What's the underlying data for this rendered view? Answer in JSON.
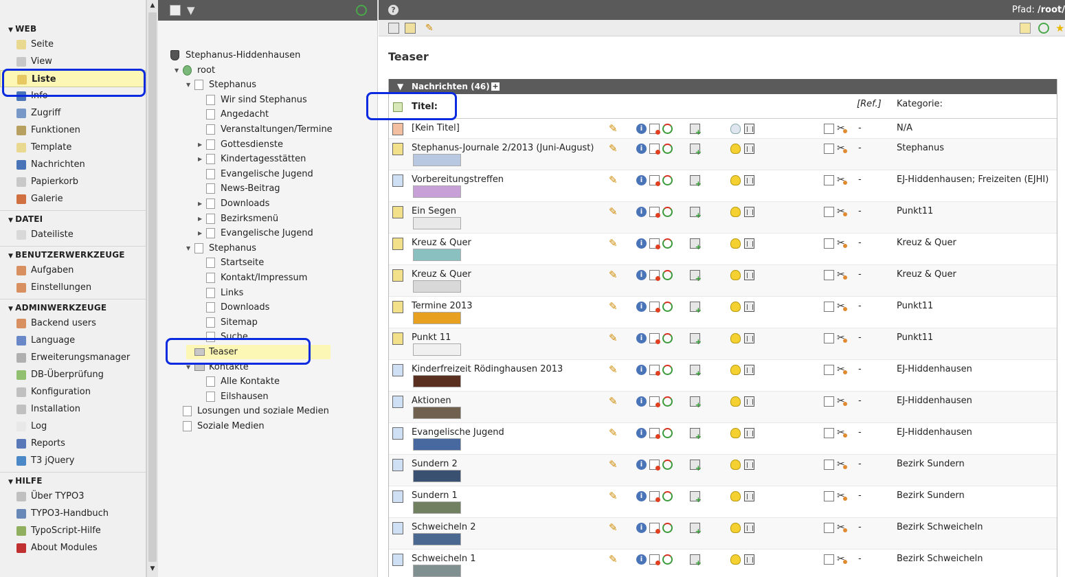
{
  "modmenu": {
    "groups": [
      {
        "title": "WEB",
        "items": [
          {
            "label": "Seite",
            "icon": "page-icon",
            "color": "#e8d890"
          },
          {
            "label": "View",
            "icon": "eye-icon",
            "color": "#c8c8c8"
          },
          {
            "label": "Liste",
            "icon": "list-icon",
            "color": "#e8c860"
          },
          {
            "label": "Info",
            "icon": "info-icon",
            "color": "#4a74b8"
          },
          {
            "label": "Zugriff",
            "icon": "access-icon",
            "color": "#7898c8"
          },
          {
            "label": "Funktionen",
            "icon": "wrench-icon",
            "color": "#b8a060"
          },
          {
            "label": "Template",
            "icon": "template-icon",
            "color": "#e8d890"
          },
          {
            "label": "Nachrichten",
            "icon": "news-icon",
            "color": "#4a74b8"
          },
          {
            "label": "Papierkorb",
            "icon": "trash-icon",
            "color": "#c8c8c8"
          },
          {
            "label": "Galerie",
            "icon": "gallery-icon",
            "color": "#d07040"
          }
        ]
      },
      {
        "title": "DATEI",
        "items": [
          {
            "label": "Dateiliste",
            "icon": "folder-icon",
            "color": "#d8d8d8"
          }
        ]
      },
      {
        "title": "BENUTZERWERKZEUGE",
        "items": [
          {
            "label": "Aufgaben",
            "icon": "tasks-icon",
            "color": "#d89060"
          },
          {
            "label": "Einstellungen",
            "icon": "user-settings-icon",
            "color": "#d89060"
          }
        ]
      },
      {
        "title": "ADMINWERKZEUGE",
        "items": [
          {
            "label": "Backend users",
            "icon": "users-icon",
            "color": "#d89060"
          },
          {
            "label": "Language",
            "icon": "language-icon",
            "color": "#6888c8"
          },
          {
            "label": "Erweiterungsmanager",
            "icon": "extension-icon",
            "color": "#b0b0b0"
          },
          {
            "label": "DB-Überprüfung",
            "icon": "db-check-icon",
            "color": "#90c070"
          },
          {
            "label": "Konfiguration",
            "icon": "config-icon",
            "color": "#c0c0c0"
          },
          {
            "label": "Installation",
            "icon": "install-icon",
            "color": "#c0c0c0"
          },
          {
            "label": "Log",
            "icon": "log-icon",
            "color": "#e8e8e8"
          },
          {
            "label": "Reports",
            "icon": "reports-icon",
            "color": "#5878b8"
          },
          {
            "label": "T3 jQuery",
            "icon": "jquery-icon",
            "color": "#4a88c8"
          }
        ]
      },
      {
        "title": "HILFE",
        "items": [
          {
            "label": "Über TYPO3",
            "icon": "about-icon",
            "color": "#c0c0c0"
          },
          {
            "label": "TYPO3-Handbuch",
            "icon": "manual-icon",
            "color": "#6888b8"
          },
          {
            "label": "TypoScript-Hilfe",
            "icon": "typoscript-icon",
            "color": "#90b060"
          },
          {
            "label": "About Modules",
            "icon": "about-modules-icon",
            "color": "#c03030"
          }
        ]
      }
    ]
  },
  "tree": {
    "nodes": [
      {
        "label": "Stephanus-Hiddenhausen",
        "level": 0,
        "exp": "",
        "kind": "site"
      },
      {
        "label": "root",
        "level": 1,
        "exp": "▼",
        "kind": "root"
      },
      {
        "label": "Stephanus",
        "level": 2,
        "exp": "▼",
        "kind": "page"
      },
      {
        "label": "Wir sind Stephanus",
        "level": 3,
        "exp": "",
        "kind": "page"
      },
      {
        "label": "Angedacht",
        "level": 3,
        "exp": "",
        "kind": "page"
      },
      {
        "label": "Veranstaltungen/Termine",
        "level": 3,
        "exp": "",
        "kind": "page"
      },
      {
        "label": "Gottesdienste",
        "level": 3,
        "exp": "▶",
        "kind": "page"
      },
      {
        "label": "Kindertagesstätten",
        "level": 3,
        "exp": "▶",
        "kind": "page"
      },
      {
        "label": "Evangelische Jugend",
        "level": 3,
        "exp": "",
        "kind": "page"
      },
      {
        "label": "News-Beitrag",
        "level": 3,
        "exp": "",
        "kind": "page"
      },
      {
        "label": "Downloads",
        "level": 3,
        "exp": "▶",
        "kind": "page"
      },
      {
        "label": "Bezirksmenü",
        "level": 3,
        "exp": "▶",
        "kind": "page"
      },
      {
        "label": "Evangelische Jugend",
        "level": 3,
        "exp": "▶",
        "kind": "page"
      },
      {
        "label": "Stephanus",
        "level": 2,
        "exp": "▼",
        "kind": "page"
      },
      {
        "label": "Startseite",
        "level": 3,
        "exp": "",
        "kind": "page"
      },
      {
        "label": "Kontakt/Impressum",
        "level": 3,
        "exp": "",
        "kind": "page"
      },
      {
        "label": "Links",
        "level": 3,
        "exp": "",
        "kind": "page"
      },
      {
        "label": "Downloads",
        "level": 3,
        "exp": "",
        "kind": "page"
      },
      {
        "label": "Sitemap",
        "level": 3,
        "exp": "",
        "kind": "page"
      },
      {
        "label": "Suche",
        "level": 3,
        "exp": "",
        "kind": "page"
      },
      {
        "label": "Teaser",
        "level": 2,
        "exp": "",
        "kind": "folder"
      },
      {
        "label": "Kontakte",
        "level": 2,
        "exp": "▼",
        "kind": "folder"
      },
      {
        "label": "Alle Kontakte",
        "level": 3,
        "exp": "",
        "kind": "page"
      },
      {
        "label": "Eilshausen",
        "level": 3,
        "exp": "",
        "kind": "page"
      },
      {
        "label": "Losungen und soziale Medien",
        "level": 1,
        "exp": "",
        "kind": "page"
      },
      {
        "label": "Soziale Medien",
        "level": 1,
        "exp": "",
        "kind": "page"
      }
    ]
  },
  "main": {
    "help_label": "?",
    "path_prefix": "Pfad: ",
    "path_value": "/root/",
    "page_title": "Teaser",
    "table": {
      "section_title": "Nachrichten (46)",
      "plus": "+",
      "col_title": "Titel:",
      "col_ref": "[Ref.]",
      "col_category": "Kategorie:",
      "rows": [
        {
          "title": "[Kein Titel]",
          "ref": "-",
          "category": "N/A",
          "icon": "red",
          "thumb": "",
          "hidden": true
        },
        {
          "title": "Stephanus-Journale 2/2013 (Juni-August)",
          "ref": "-",
          "category": "Stephanus",
          "icon": "yellow",
          "thumb": "#b8c8e0",
          "hidden": false
        },
        {
          "title": "Vorbereitungstreffen",
          "ref": "-",
          "category": "EJ-Hiddenhausen; Freizeiten (EJHI)",
          "icon": "blue",
          "thumb": "#c8a0d8",
          "hidden": false
        },
        {
          "title": "Ein Segen",
          "ref": "-",
          "category": "Punkt11",
          "icon": "yellow",
          "thumb": "#e8e8e8",
          "hidden": false
        },
        {
          "title": "Kreuz & Quer",
          "ref": "-",
          "category": "Kreuz & Quer",
          "icon": "yellow",
          "thumb": "#8ac0c0",
          "hidden": false
        },
        {
          "title": "Kreuz & Quer",
          "ref": "-",
          "category": "Kreuz & Quer",
          "icon": "yellow",
          "thumb": "#d8d8d8",
          "hidden": false
        },
        {
          "title": "Termine 2013",
          "ref": "-",
          "category": "Punkt11",
          "icon": "yellow",
          "thumb": "#e8a020",
          "hidden": false
        },
        {
          "title": "Punkt 11",
          "ref": "-",
          "category": "Punkt11",
          "icon": "yellow",
          "thumb": "#f0f0f0",
          "hidden": false
        },
        {
          "title": "Kinderfreizeit Rödinghausen 2013",
          "ref": "-",
          "category": "EJ-Hiddenhausen",
          "icon": "blue",
          "thumb": "#5a3020",
          "hidden": false
        },
        {
          "title": "Aktionen",
          "ref": "-",
          "category": "EJ-Hiddenhausen",
          "icon": "blue",
          "thumb": "#706050",
          "hidden": false
        },
        {
          "title": "Evangelische Jugend",
          "ref": "-",
          "category": "EJ-Hiddenhausen",
          "icon": "blue",
          "thumb": "#4868a0",
          "hidden": false
        },
        {
          "title": "Sundern 2",
          "ref": "-",
          "category": "Bezirk Sundern",
          "icon": "blue",
          "thumb": "#3a5070",
          "hidden": false
        },
        {
          "title": "Sundern 1",
          "ref": "-",
          "category": "Bezirk Sundern",
          "icon": "blue",
          "thumb": "#708060",
          "hidden": false
        },
        {
          "title": "Schweicheln 2",
          "ref": "-",
          "category": "Bezirk Schweicheln",
          "icon": "blue",
          "thumb": "#4a6890",
          "hidden": false
        },
        {
          "title": "Schweicheln 1",
          "ref": "-",
          "category": "Bezirk Schweicheln",
          "icon": "blue",
          "thumb": "#809090",
          "hidden": false
        }
      ]
    }
  }
}
